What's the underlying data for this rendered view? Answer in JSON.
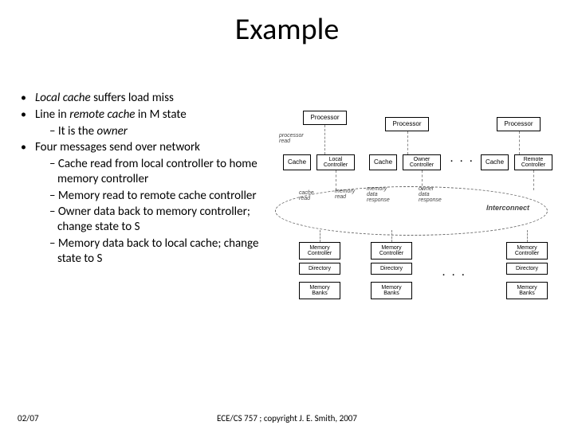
{
  "title": "Example",
  "bullets": {
    "b1_pre": "Local cache",
    "b1_rest": " suffers load miss",
    "b2_pre": "Line in ",
    "b2_em": "remote cache",
    "b2_rest": " in  M state",
    "b2_sub_pre": "– It is the ",
    "b2_sub_em": "owner",
    "b3": "Four messages send over network",
    "b3_s1": "– Cache read from local controller to home memory controller",
    "b3_s2": "– Memory read to remote cache controller",
    "b3_s3": "– Owner data back to memory controller; change state to S",
    "b3_s4": "– Memory data back to local cache; change state to S"
  },
  "diagram": {
    "processor": "Processor",
    "cache": "Cache",
    "local_ctrl": "Local\nController",
    "owner_ctrl": "Owner\nController",
    "remote_ctrl": "Remote\nController",
    "mem_ctrl": "Memory\nController",
    "directory": "Directory",
    "mem_banks": "Memory\nBanks",
    "proc_read": "processor\nread",
    "cache_read": "cache\nread",
    "mem_data_resp": "memory\ndata\nresponse",
    "owner_data_resp": "owner\ndata\nresponse",
    "interconnect": "Interconnect",
    "dots": ". . ."
  },
  "footer": {
    "date": "02/07",
    "copyright": "ECE/CS 757 ; copyright J. E. Smith, 2007"
  }
}
